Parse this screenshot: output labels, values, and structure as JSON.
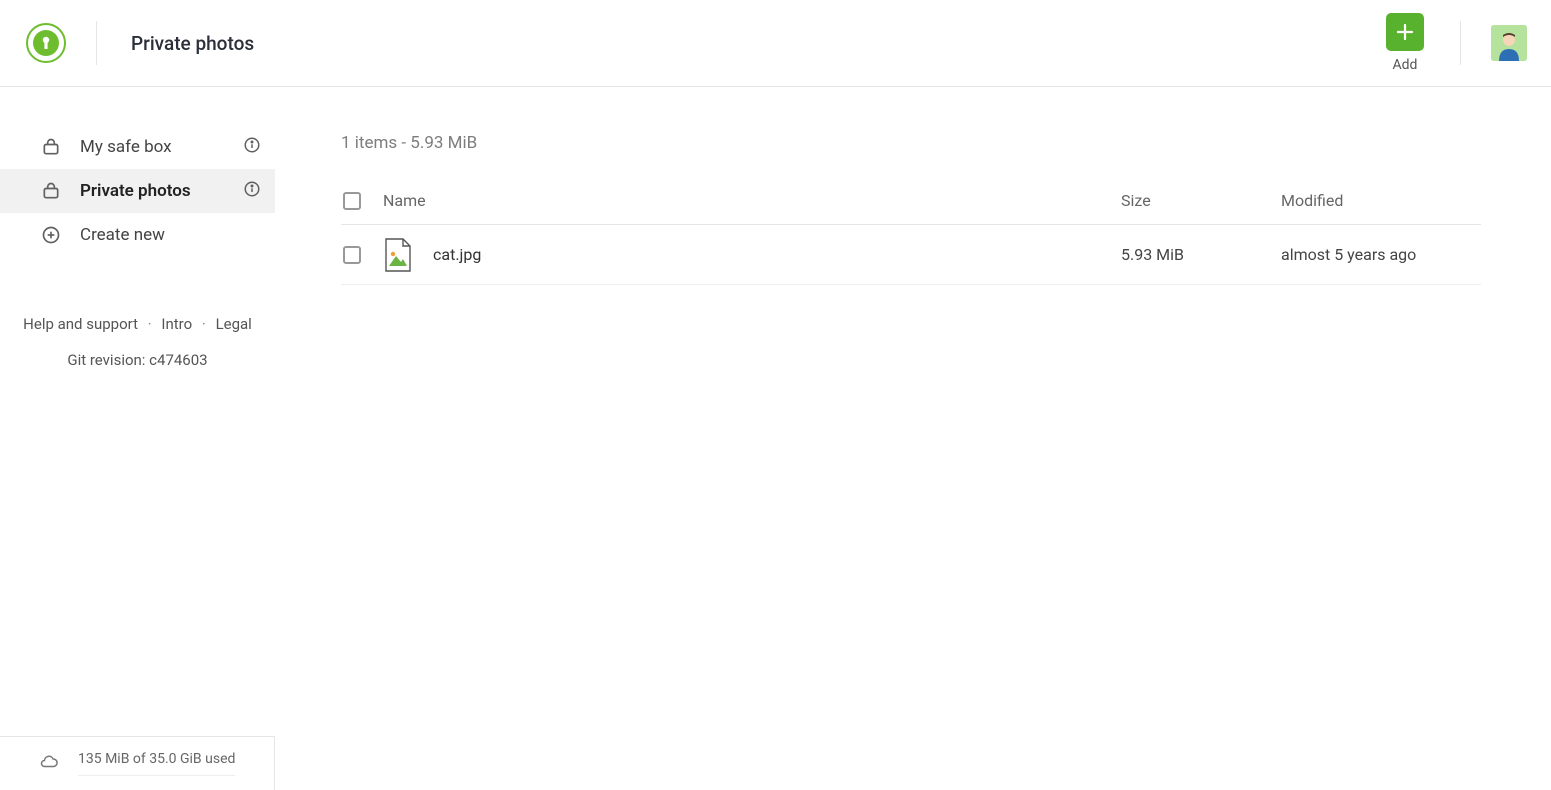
{
  "header": {
    "title": "Private photos",
    "add_label": "Add"
  },
  "sidebar": {
    "items": [
      {
        "label": "My safe box",
        "info": true
      },
      {
        "label": "Private photos",
        "info": true,
        "active": true
      },
      {
        "label": "Create new"
      }
    ],
    "links": {
      "help": "Help and support",
      "intro": "Intro",
      "legal": "Legal"
    },
    "git_revision": "Git revision: c474603"
  },
  "content": {
    "summary": "1 items - 5.93 MiB",
    "columns": {
      "name": "Name",
      "size": "Size",
      "modified": "Modified"
    },
    "rows": [
      {
        "name": "cat.jpg",
        "size": "5.93 MiB",
        "modified": "almost 5 years ago"
      }
    ]
  },
  "storage": {
    "text": "135 MiB of 35.0 GiB used"
  }
}
